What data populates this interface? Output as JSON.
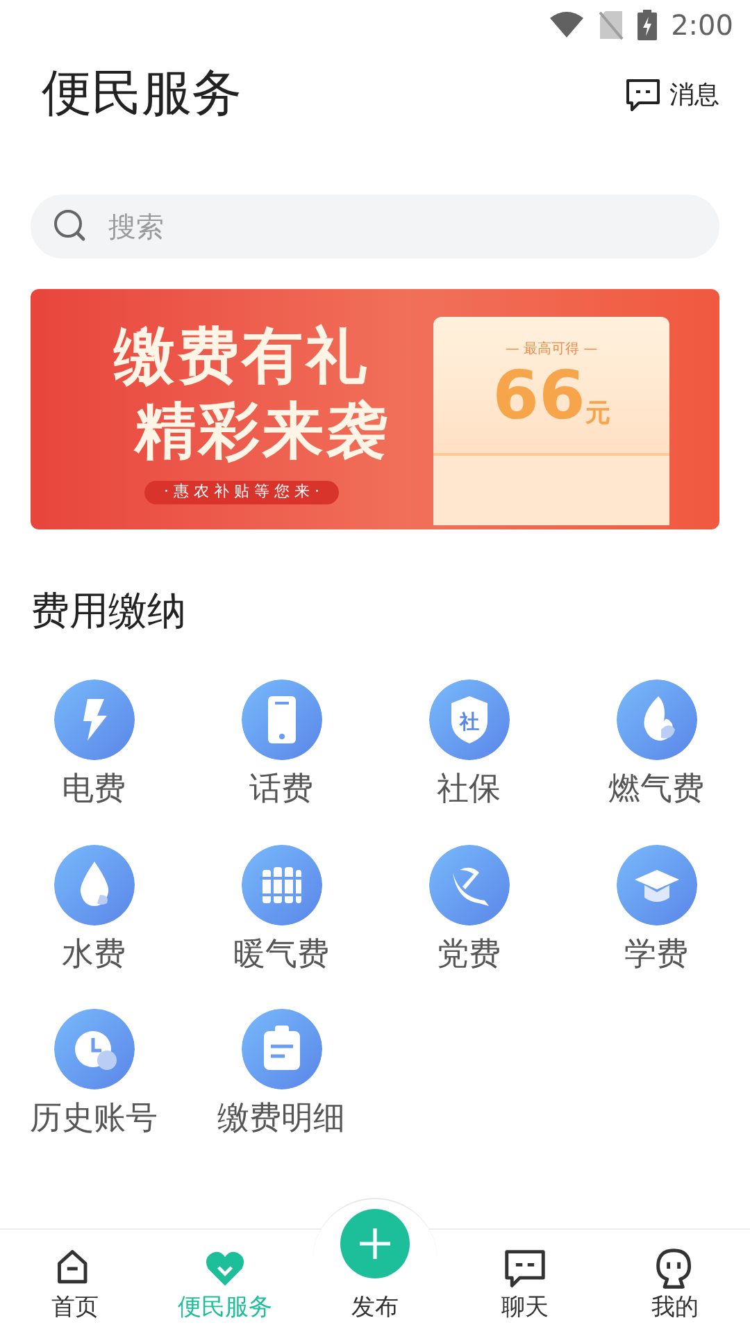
{
  "status_bar": {
    "time": "2:00"
  },
  "header": {
    "title": "便民服务",
    "message_label": "消息"
  },
  "search": {
    "placeholder": "搜索"
  },
  "banner": {
    "headline_1": "缴费有礼",
    "headline_2": "精彩来袭",
    "subtitle": "· 惠 农 补 贴 等 您 来 ·",
    "ticket_caption": "— 最高可得 —",
    "amount": "66",
    "unit": "元"
  },
  "section": {
    "title": "费用缴纳"
  },
  "services": [
    {
      "label": "电费",
      "kind": "bolt"
    },
    {
      "label": "话费",
      "kind": "phone"
    },
    {
      "label": "社保",
      "kind": "shield",
      "icon_text": "社"
    },
    {
      "label": "燃气费",
      "kind": "flame"
    },
    {
      "label": "水费",
      "kind": "drop"
    },
    {
      "label": "暖气费",
      "kind": "radiator"
    },
    {
      "label": "党费",
      "kind": "emblem"
    },
    {
      "label": "学费",
      "kind": "cap"
    },
    {
      "label": "历史账号",
      "kind": "clock"
    },
    {
      "label": "缴费明细",
      "kind": "clipboard"
    }
  ],
  "bottom_nav": [
    {
      "label": "首页",
      "kind": "home",
      "selected": false
    },
    {
      "label": "便民服务",
      "kind": "heart",
      "selected": true
    },
    {
      "label": "发布",
      "kind": "plus",
      "selected": false
    },
    {
      "label": "聊天",
      "kind": "chat",
      "selected": false
    },
    {
      "label": "我的",
      "kind": "ghost",
      "selected": false
    }
  ]
}
